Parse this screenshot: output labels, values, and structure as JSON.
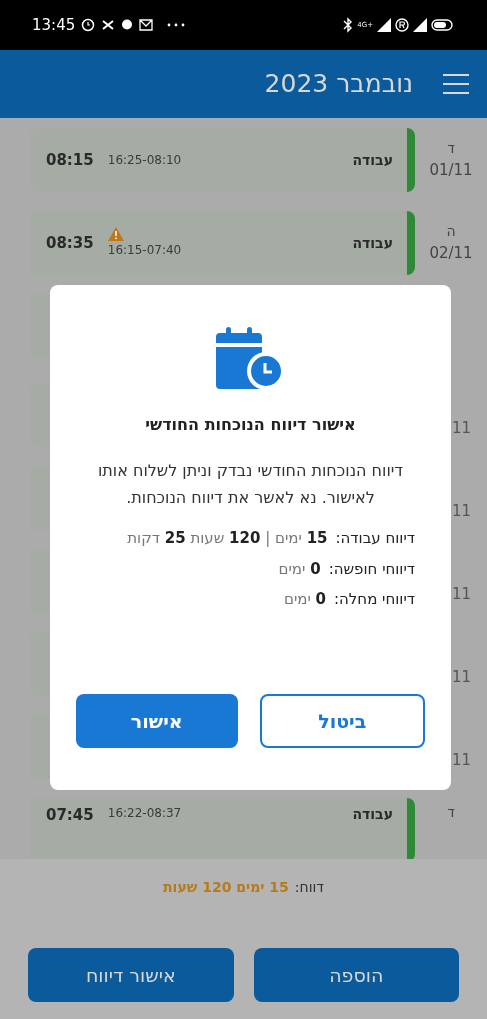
{
  "status_bar": {
    "time": "13:45",
    "network": "4G+"
  },
  "header": {
    "title": "נובמבר 2023"
  },
  "rows": [
    {
      "kind": "full",
      "day": "ד",
      "date": "01/11",
      "type": "עבודה",
      "range": "16:25-08:10",
      "total": "08:15",
      "warning": false,
      "color": "#2e8a37"
    },
    {
      "kind": "full",
      "day": "ה",
      "date": "02/11",
      "type": "עבודה",
      "range": "16:15-07:40",
      "total": "08:35",
      "warning": true,
      "color": "#2e8a37"
    },
    {
      "kind": "covered"
    },
    {
      "kind": "covered",
      "date": "11"
    },
    {
      "kind": "covered",
      "date": "11"
    },
    {
      "kind": "covered",
      "date": "11"
    },
    {
      "kind": "covered",
      "date": "11"
    },
    {
      "kind": "covered",
      "date": "11"
    },
    {
      "kind": "full",
      "day": "ד",
      "type": "עבודה",
      "range": "16:22-08:37",
      "total": "07:45",
      "warning": false,
      "color": "#2e8a37"
    }
  ],
  "summary": {
    "label": "דווח:",
    "value": "15 ימים 120 שעות"
  },
  "buttons": [
    "הוספה",
    "אישור דיווח"
  ],
  "dialog": {
    "title": "אישור דיווח הנוכחות החודשי",
    "message": "דיווח הנוכחות החודשי נבדק וניתן לשלוח אותו לאישור. נא לאשר את דיווח הנוכחות.",
    "stats": [
      {
        "label": "דיווח עבודה:",
        "value": "**15** ימים | **120** שעות **25** דקות"
      },
      {
        "label": "דיווחי חופשה:",
        "value": "**0** ימים"
      },
      {
        "label": "דיווחי מחלה:",
        "value": "**0** ימים"
      }
    ],
    "cancel": "ביטול",
    "confirm": "אישור"
  }
}
